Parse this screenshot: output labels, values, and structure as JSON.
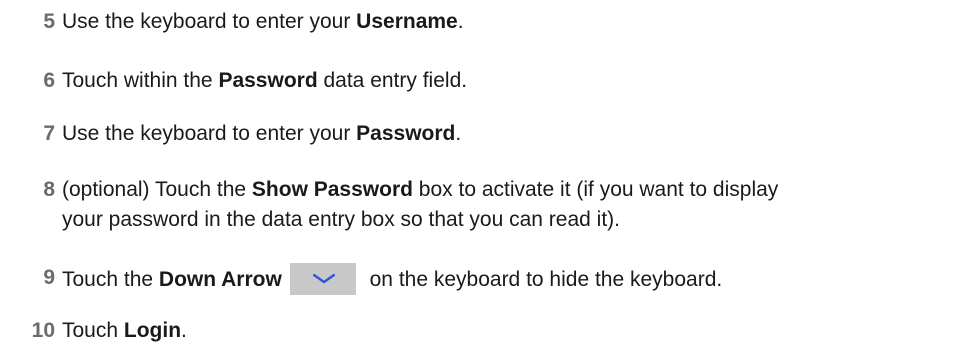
{
  "steps": [
    {
      "number": "5",
      "pre": "Use the keyboard to enter your ",
      "bold": "Username",
      "post": "."
    },
    {
      "number": "6",
      "pre": "Touch within the ",
      "bold": "Password",
      "post": " data entry field."
    },
    {
      "number": "7",
      "pre": "Use the keyboard to enter your ",
      "bold": "Password",
      "post": "."
    },
    {
      "number": "8",
      "pre": "(optional) Touch the ",
      "bold": "Show Password",
      "post": " box to activate it (if you want to display",
      "line2": "your password in the data entry box so that you can read it)."
    },
    {
      "number": "9",
      "pre": "Touch the ",
      "bold": "Down Arrow",
      "post": " on the keyboard to hide the keyboard.",
      "key_icon": "chevron-down-icon",
      "key_color": "#c8c8c8",
      "icon_color": "#2f55d4"
    },
    {
      "number": "10",
      "pre": "Touch ",
      "bold": "Login",
      "post": "."
    }
  ]
}
